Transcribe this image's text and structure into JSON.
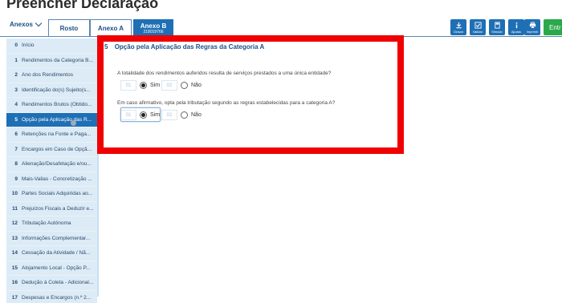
{
  "page": {
    "title": "Preencher Declaração"
  },
  "tabs": {
    "anexos_label": "Anexos",
    "items": [
      {
        "label": "Rosto",
        "sub": ""
      },
      {
        "label": "Anexo A",
        "sub": ""
      },
      {
        "label": "Anexo B",
        "sub": "218019766"
      }
    ]
  },
  "toolbar": {
    "buttons": [
      {
        "label": "Gravar",
        "icon": "download-icon"
      },
      {
        "label": "Validar",
        "icon": "check-icon"
      },
      {
        "label": "Simular",
        "icon": "calculator-icon"
      },
      {
        "label": "Ajudas",
        "icon": "info-icon"
      },
      {
        "label": "Imprimir",
        "icon": "printer-icon"
      }
    ],
    "enter_label": "Entr"
  },
  "sidebar": {
    "items": [
      {
        "num": "0",
        "label": "Início"
      },
      {
        "num": "1",
        "label": "Rendimentos da Categoria B..."
      },
      {
        "num": "2",
        "label": "Ano dos Rendimentos"
      },
      {
        "num": "3",
        "label": "Identificação do(s) Sujeito(s..."
      },
      {
        "num": "4",
        "label": "Rendimentos Brutos (Obtido..."
      },
      {
        "num": "5",
        "label": "Opção pela Aplicação das R..."
      },
      {
        "num": "6",
        "label": "Retenções na Fonte e Paga..."
      },
      {
        "num": "7",
        "label": "Encargos em Caso de Opçã..."
      },
      {
        "num": "8",
        "label": "Alienação/Desafetação e/ou..."
      },
      {
        "num": "9",
        "label": "Mais-Valias - Concretização ..."
      },
      {
        "num": "10",
        "label": "Partes Sociais Adquiridas ao..."
      },
      {
        "num": "11",
        "label": "Prejuízos Fiscais a Deduzir e..."
      },
      {
        "num": "12",
        "label": "Tributação Autónoma"
      },
      {
        "num": "13",
        "label": "Informações Complementar..."
      },
      {
        "num": "14",
        "label": "Cessação da Atividade / Nã..."
      },
      {
        "num": "15",
        "label": "Alojamento Local - Opção P..."
      },
      {
        "num": "16",
        "label": "Dedução à Coleta - Adicional..."
      },
      {
        "num": "17",
        "label": "Despesas e Encargos (n.º 2..."
      }
    ],
    "active_index": 5
  },
  "section": {
    "number": "5",
    "title": "Opção pela Aplicação das Regras da Categoria A",
    "q1": {
      "text": "A totalidade dos rendimentos auferidos resulta de serviços prestados a uma única entidade?",
      "opt1_code": "01",
      "opt1_label": "Sim",
      "opt2_code": "02",
      "opt2_label": "Não",
      "selected": "Sim"
    },
    "q2": {
      "text": "Em caso afirmativo, opta pela tributação segundo as regras estabelecidas para a categoria A?",
      "opt1_code": "01",
      "opt1_label": "Sim",
      "opt2_code": "02",
      "opt2_label": "Não",
      "selected": "Sim"
    }
  },
  "colors": {
    "accent": "#1f6fb5",
    "highlight": "#f00000",
    "enter": "#2aa84a",
    "sidebar_bg": "#dcebf6"
  }
}
